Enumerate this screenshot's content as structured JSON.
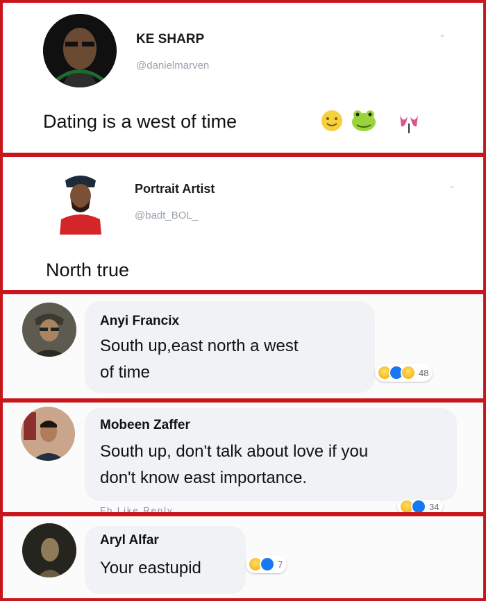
{
  "tweet1": {
    "name": "KE SHARP",
    "handle": "@danielmarven",
    "text": "Dating is a west of time",
    "emoji_icons": [
      "smiling-face-icon",
      "frog-face-icon",
      "pink-tulip-icon"
    ]
  },
  "tweet2": {
    "name": "Portrait Artist",
    "handle": "@badt_BOL_",
    "text": "North true"
  },
  "comments": [
    {
      "name": "Anyi Francix",
      "line1": "South up,east north a west",
      "line2": "of time",
      "reactions": [
        "haha-icon",
        "like-icon",
        "wow-icon"
      ],
      "count": "48"
    },
    {
      "name": "Mobeen Zaffer",
      "line1": "South up, don't talk about love if you",
      "line2": "don't know east importance.",
      "reactions": [
        "haha-icon",
        "like-icon"
      ],
      "count": "34",
      "actions_cut": "Fb  Like  Reply"
    },
    {
      "name": "Aryl Alfar",
      "line1": "Your eastupid",
      "reactions": [
        "haha-icon",
        "like-icon"
      ],
      "count": "7"
    }
  ],
  "colors": {
    "frame": "#c8161d",
    "bubble": "#f0f2f5",
    "like": "#1877f2",
    "haha": "#f7b928"
  }
}
